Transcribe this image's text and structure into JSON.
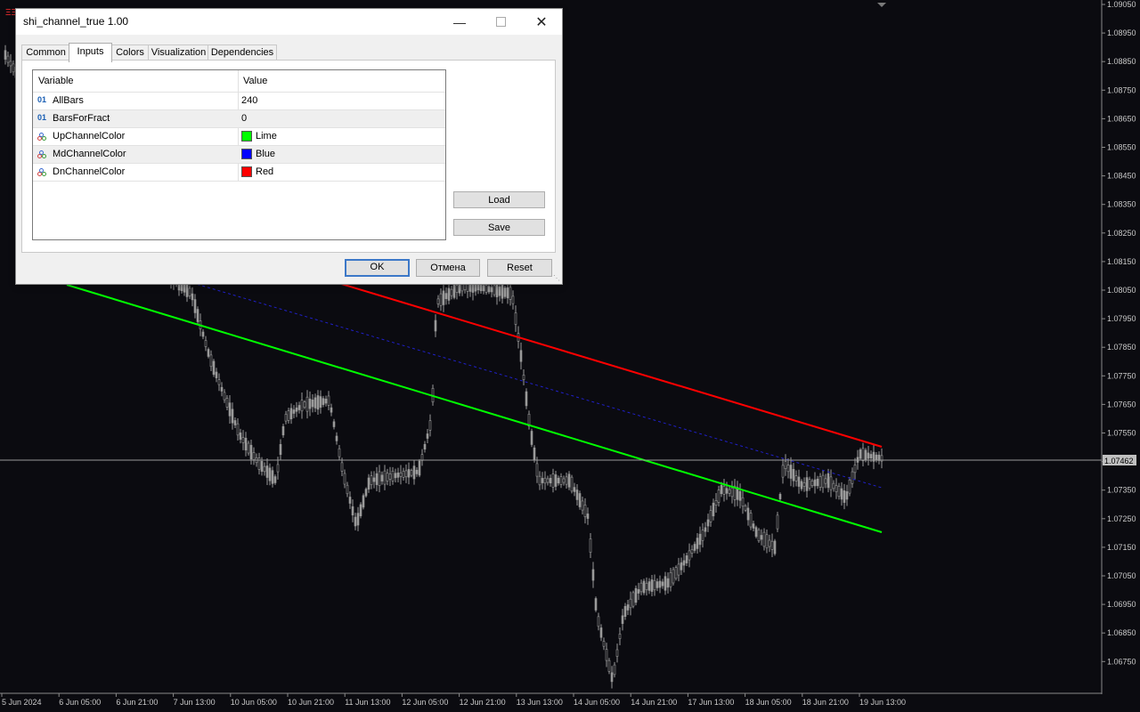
{
  "dialog": {
    "title": "shi_channel_true 1.00",
    "tabs": [
      "Common",
      "Inputs",
      "Colors",
      "Visualization",
      "Dependencies"
    ],
    "active_tab": "Inputs",
    "columns": {
      "variable": "Variable",
      "value": "Value"
    },
    "params": [
      {
        "icon": "01",
        "variable": "AllBars",
        "value": "240"
      },
      {
        "icon": "01",
        "variable": "BarsForFract",
        "value": "0"
      },
      {
        "icon": "color-icon",
        "variable": "UpChannelColor",
        "value": "Lime",
        "color": "#00ff00"
      },
      {
        "icon": "color-icon",
        "variable": "MdChannelColor",
        "value": "Blue",
        "color": "#0000ff"
      },
      {
        "icon": "color-icon",
        "variable": "DnChannelColor",
        "value": "Red",
        "color": "#ff0000"
      }
    ],
    "buttons": {
      "load": "Load",
      "save": "Save",
      "ok": "OK",
      "cancel": "Отмена",
      "reset": "Reset"
    }
  },
  "chart": {
    "symbol_icon": "ΞΞ",
    "price_scale": [
      "1.09050",
      "1.08950",
      "1.08850",
      "1.08750",
      "1.08650",
      "1.08550",
      "1.08450",
      "1.08350",
      "1.08250",
      "1.08150",
      "1.08050",
      "1.07950",
      "1.07850",
      "1.07750",
      "1.07650",
      "1.07550",
      "1.07450",
      "1.07350",
      "1.07250",
      "1.07150",
      "1.07050",
      "1.06950",
      "1.06850",
      "1.06750"
    ],
    "current_price": "1.07462",
    "time_scale": [
      "5 Jun 2024",
      "6 Jun 05:00",
      "6 Jun 21:00",
      "7 Jun 13:00",
      "10 Jun 05:00",
      "10 Jun 21:00",
      "11 Jun 13:00",
      "12 Jun 05:00",
      "12 Jun 21:00",
      "13 Jun 13:00",
      "14 Jun 05:00",
      "14 Jun 21:00",
      "17 Jun 13:00",
      "18 Jun 05:00",
      "18 Jun 21:00",
      "19 Jun 13:00"
    ],
    "colors": {
      "background": "#0b0b10",
      "candle": "#9a9a9a",
      "up_channel": "#00ff00",
      "md_channel": "#0000ff",
      "dn_channel": "#ff0000",
      "axis_text": "#c8c8c8"
    }
  }
}
